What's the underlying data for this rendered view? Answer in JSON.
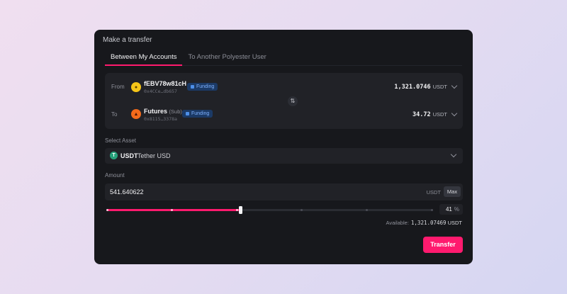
{
  "modal": {
    "title": "Make a transfer"
  },
  "tabs": [
    {
      "label": "Between My Accounts",
      "active": true
    },
    {
      "label": "To Another Polyester User",
      "active": false
    }
  ],
  "from": {
    "label": "From",
    "name": "fEBV78w81cH",
    "address": "0x4CCe…db657",
    "badge": "Funding",
    "balance": "1,321.0746",
    "unit": "USDT",
    "icon": "coin-stack-icon"
  },
  "to": {
    "label": "To",
    "name": "Futures",
    "sub": "(Sub)",
    "address": "0x8115…3378a",
    "badge": "Funding",
    "balance": "34.72",
    "unit": "USDT",
    "icon": "futures-icon"
  },
  "asset": {
    "section_label": "Select Asset",
    "symbol": "USDT",
    "name": "Tether USD"
  },
  "amount": {
    "section_label": "Amount",
    "value": "541.640622",
    "unit": "USDT",
    "max_label": "Max",
    "percent": "41",
    "percent_unit": "%",
    "slider_fraction": 0.41
  },
  "available": {
    "label": "Available:",
    "value": "1,321.07469",
    "unit": "USDT"
  },
  "transfer_label": "Transfer",
  "colors": {
    "accent": "#ff1a6e",
    "badge_bg": "#1b3a66",
    "badge_text": "#7fb2ff"
  }
}
